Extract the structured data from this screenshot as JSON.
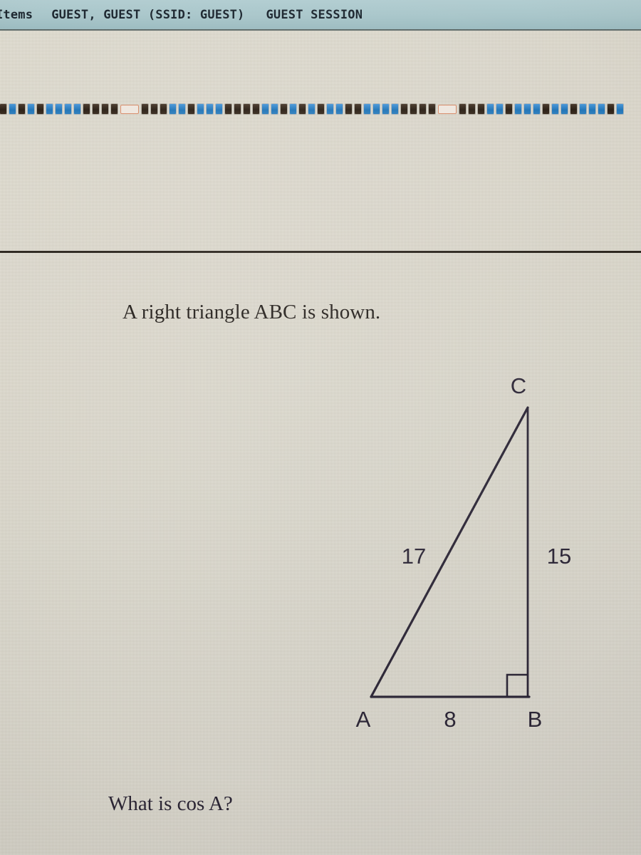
{
  "topbar": {
    "items_label": "Items",
    "user_label": "GUEST, GUEST (SSID: GUEST)",
    "session_label": "GUEST SESSION",
    "background_color": "#a9c6ca",
    "text_color": "#1d2730"
  },
  "nav_strip": {
    "current_marker_color": "#d88c6a",
    "answered_color": "#2b2016",
    "unanswered_color": "#2175b8",
    "items": [
      {
        "state": "dark"
      },
      {
        "state": "blue"
      },
      {
        "state": "dark"
      },
      {
        "state": "blue"
      },
      {
        "state": "dark"
      },
      {
        "state": "blue"
      },
      {
        "state": "blue"
      },
      {
        "state": "blue"
      },
      {
        "state": "blue"
      },
      {
        "state": "dark"
      },
      {
        "state": "dark"
      },
      {
        "state": "dark"
      },
      {
        "state": "dark"
      },
      {
        "state": "current"
      },
      {
        "state": "dark"
      },
      {
        "state": "dark"
      },
      {
        "state": "dark"
      },
      {
        "state": "blue"
      },
      {
        "state": "blue"
      },
      {
        "state": "dark"
      },
      {
        "state": "blue"
      },
      {
        "state": "blue"
      },
      {
        "state": "blue"
      },
      {
        "state": "dark"
      },
      {
        "state": "dark"
      },
      {
        "state": "dark"
      },
      {
        "state": "dark"
      },
      {
        "state": "blue"
      },
      {
        "state": "blue"
      },
      {
        "state": "dark"
      },
      {
        "state": "blue"
      },
      {
        "state": "dark"
      },
      {
        "state": "blue"
      },
      {
        "state": "dark"
      },
      {
        "state": "blue"
      },
      {
        "state": "blue"
      },
      {
        "state": "dark"
      },
      {
        "state": "dark"
      },
      {
        "state": "blue"
      },
      {
        "state": "blue"
      },
      {
        "state": "blue"
      },
      {
        "state": "blue"
      },
      {
        "state": "dark"
      },
      {
        "state": "dark"
      },
      {
        "state": "dark"
      },
      {
        "state": "dark"
      },
      {
        "state": "current"
      },
      {
        "state": "dark"
      },
      {
        "state": "dark"
      },
      {
        "state": "dark"
      },
      {
        "state": "blue"
      },
      {
        "state": "blue"
      },
      {
        "state": "dark"
      },
      {
        "state": "blue"
      },
      {
        "state": "blue"
      },
      {
        "state": "blue"
      },
      {
        "state": "dark"
      },
      {
        "state": "blue"
      },
      {
        "state": "blue"
      },
      {
        "state": "dark"
      },
      {
        "state": "blue"
      },
      {
        "state": "blue"
      },
      {
        "state": "blue"
      },
      {
        "state": "dark"
      },
      {
        "state": "blue"
      }
    ]
  },
  "question": {
    "stem": "A right triangle ABC is shown.",
    "prompt": "What is cos A?"
  },
  "figure": {
    "type": "right-triangle",
    "vertices": [
      {
        "label": "A",
        "position": "bottom-left"
      },
      {
        "label": "B",
        "position": "bottom-right"
      },
      {
        "label": "C",
        "position": "top-right"
      }
    ],
    "right_angle_at": "B",
    "sides": [
      {
        "name": "AB",
        "label": "8",
        "orientation": "horizontal-base"
      },
      {
        "name": "BC",
        "label": "15",
        "orientation": "vertical-right"
      },
      {
        "name": "AC",
        "label": "17",
        "orientation": "hypotenuse"
      }
    ],
    "vertex_labels": {
      "a": "A",
      "b": "B",
      "c": "C"
    },
    "side_labels": {
      "base": "8",
      "vertical": "15",
      "hypotenuse": "17"
    },
    "stroke_color": "#2b2535"
  }
}
